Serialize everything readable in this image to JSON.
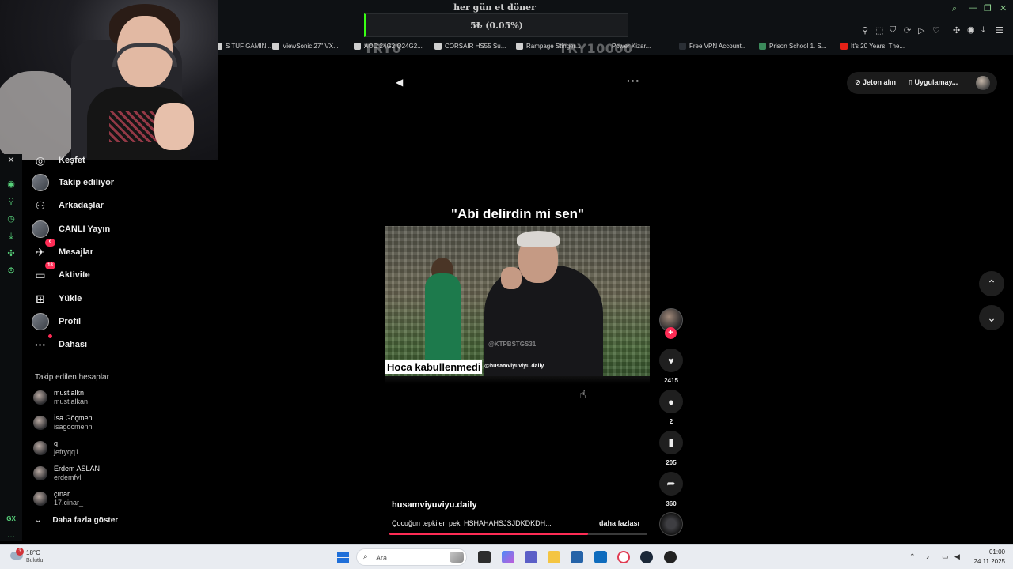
{
  "overlay": {
    "donation_title": "her gün et döner",
    "donation_amount": "5₺ (0.05%)",
    "left_label": "TRY0",
    "right_label": "TRY10000"
  },
  "bookmarks": [
    {
      "label": "S TUF GAMIN...",
      "icon": "bookmark-favicon"
    },
    {
      "label": "ViewSonic 27\" VX...",
      "icon": "bookmark-favicon"
    },
    {
      "label": "AOC 24G2 Q24G2...",
      "icon": "bookmark-favicon"
    },
    {
      "label": "CORSAIR HS55 Su...",
      "icon": "bookmark-favicon"
    },
    {
      "label": "Rampage Stinger...",
      "icon": "bookmark-favicon"
    },
    {
      "label": "Power Kizar...",
      "icon": "bookmark-favicon"
    },
    {
      "label": "Free VPN Account...",
      "icon": "vpn-favicon"
    },
    {
      "label": "Prison School 1. S...",
      "icon": "anime-favicon"
    },
    {
      "label": "It's 20 Years, The...",
      "icon": "youtube-favicon"
    }
  ],
  "sidebar": {
    "items": [
      {
        "label": "Keşfet",
        "icon": "compass-icon"
      },
      {
        "label": "Takip ediliyor",
        "icon": "following-avatar-icon"
      },
      {
        "label": "Arkadaşlar",
        "icon": "friends-icon"
      },
      {
        "label": "CANLI Yayın",
        "icon": "live-avatar-icon"
      },
      {
        "label": "Mesajlar",
        "icon": "messages-icon",
        "badge": "9"
      },
      {
        "label": "Aktivite",
        "icon": "activity-icon",
        "badge": "18"
      },
      {
        "label": "Yükle",
        "icon": "upload-icon"
      },
      {
        "label": "Profil",
        "icon": "profile-avatar-icon"
      },
      {
        "label": "Dahası",
        "icon": "more-icon"
      }
    ],
    "following_title": "Takip edilen hesaplar",
    "accounts": [
      {
        "name": "mustialkn",
        "handle": "mustialkan"
      },
      {
        "name": "İsa Göçmen",
        "handle": "isagocmenn"
      },
      {
        "name": "q",
        "handle": "jefryqq1"
      },
      {
        "name": "Erdem ASLAN",
        "handle": "erdemfvl"
      },
      {
        "name": "çınar",
        "handle": "17.cinar_"
      }
    ],
    "show_more": "Daha fazla göster"
  },
  "video": {
    "caption": "\"Abi delirdin mi sen\"",
    "subtitle": "Hoca kabullenmedi",
    "watermark_handle": "@husamviyuviyu.daily",
    "watermark_logo": "@KTPBSTGS31",
    "likes": "2415",
    "comments": "2",
    "saves": "205",
    "shares": "360",
    "author": "husamviyuviyu.daily",
    "description": "Çocuğun tepkileri peki HSHAHAHSJSJDKDKDH...",
    "more_label": "daha fazlası",
    "progress": 0.77
  },
  "topright": {
    "coins": "Jeton alın",
    "app": "Uygulamay..."
  },
  "taskbar": {
    "temperature": "18°C",
    "weather": "Bulutlu",
    "weather_badge": "3",
    "search_placeholder": "Ara",
    "time": "01:00",
    "date": "24.11.2025"
  },
  "colors": {
    "accent": "#fe2c55",
    "opera_gx": "#57d17a",
    "background": "#000000"
  }
}
